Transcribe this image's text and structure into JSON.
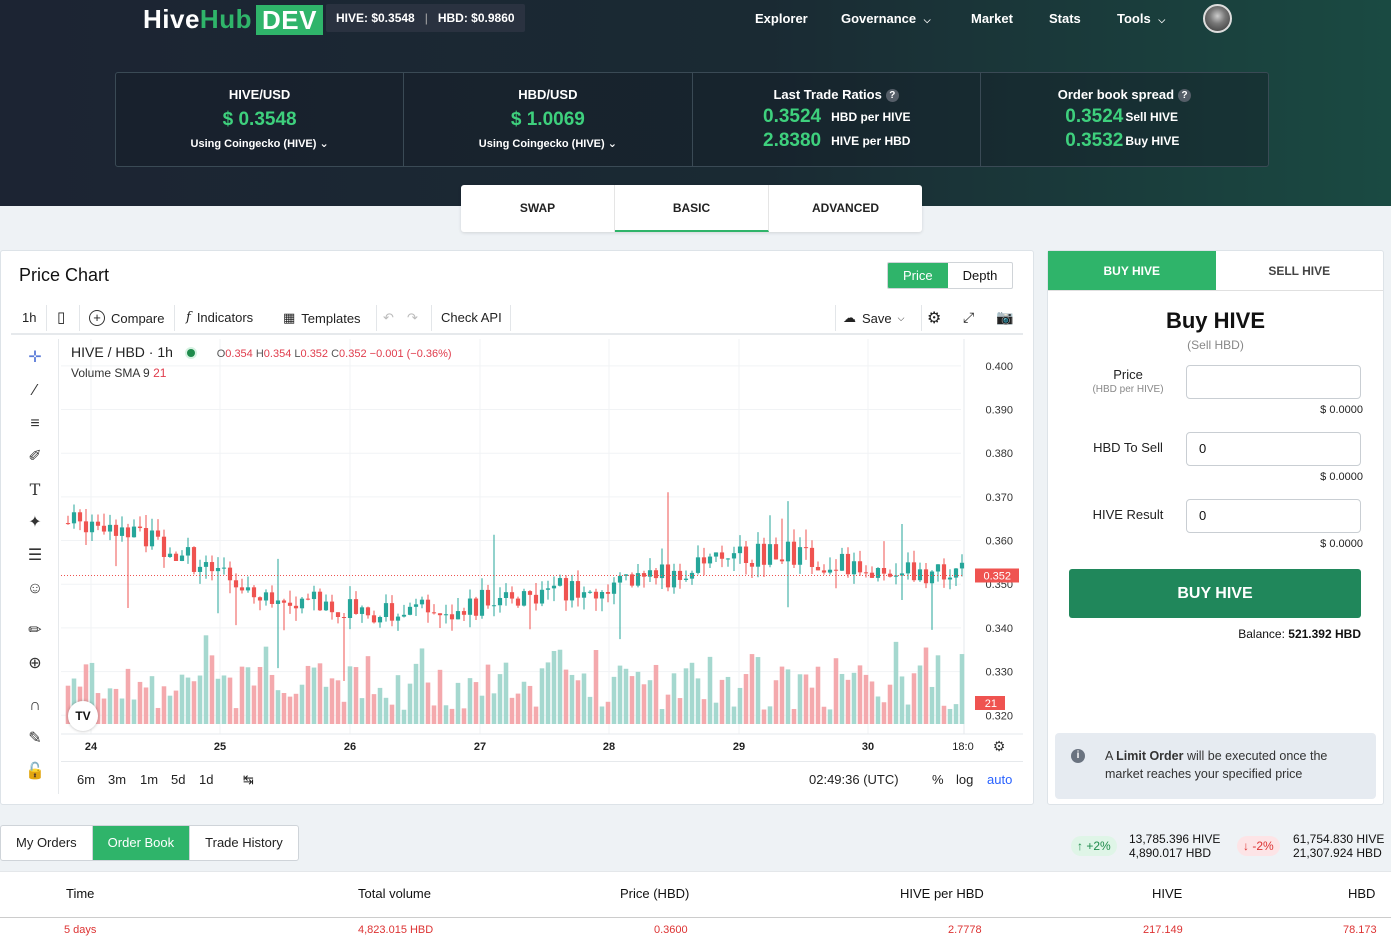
{
  "header": {
    "logo_a": "Hive",
    "logo_b": "Hub",
    "logo_dev": "DEV",
    "ticker_hive": "HIVE: $0.3548",
    "ticker_hbd": "HBD: $0.9860",
    "nav": [
      "Explorer",
      "Governance",
      "Market",
      "Stats",
      "Tools"
    ]
  },
  "stats": {
    "hive_usd": {
      "title": "HIVE/USD",
      "value": "$ 0.3548",
      "source": "Using Coingecko (HIVE)"
    },
    "hbd_usd": {
      "title": "HBD/USD",
      "value": "$ 1.0069",
      "source": "Using Coingecko (HIVE)"
    },
    "ratios": {
      "title": "Last Trade Ratios",
      "v1": "0.3524",
      "t1": "HBD per HIVE",
      "v2": "2.8380",
      "t2": "HIVE per HBD"
    },
    "spread": {
      "title": "Order book spread",
      "v1": "0.3524",
      "t1": "Sell HIVE",
      "v2": "0.3532",
      "t2": "Buy HIVE"
    }
  },
  "mode_tabs": [
    "SWAP",
    "BASIC",
    "ADVANCED"
  ],
  "chart": {
    "title": "Price Chart",
    "toggle": [
      "Price",
      "Depth"
    ],
    "toolbar": {
      "interval": "1h",
      "compare": "Compare",
      "indicators": "Indicators",
      "templates": "Templates",
      "check_api": "Check API",
      "save": "Save"
    },
    "legend": {
      "symbol": "HIVE / HBD · 1h",
      "o": "0.354",
      "h": "0.354",
      "l": "0.352",
      "c": "0.352",
      "chg": "−0.001 (−0.36%)",
      "volume": "Volume SMA 9",
      "volume_val": "21"
    },
    "price_label": "0.352",
    "volume_label": "21",
    "bottom": {
      "ranges": [
        "6m",
        "3m",
        "1m",
        "5d",
        "1d"
      ],
      "time": "02:49:36 (UTC)",
      "pct": "%",
      "log": "log",
      "auto": "auto"
    }
  },
  "chart_data": {
    "type": "candlestick",
    "title": "",
    "y_ticks": [
      "0.400",
      "0.390",
      "0.380",
      "0.370",
      "0.360",
      "0.350",
      "0.340",
      "0.330",
      "0.320"
    ],
    "x_ticks": [
      "24",
      "25",
      "26",
      "27",
      "28",
      "29",
      "30",
      "18:0"
    ],
    "ylim": [
      0.318,
      0.405
    ],
    "last_close": 0.352,
    "trend": [
      0.364,
      0.365,
      0.363,
      0.36,
      0.356,
      0.353,
      0.35,
      0.348,
      0.346,
      0.345,
      0.344,
      0.343,
      0.344,
      0.345,
      0.346,
      0.347,
      0.348,
      0.349,
      0.35,
      0.351,
      0.352,
      0.353,
      0.355,
      0.357,
      0.358,
      0.356,
      0.354,
      0.353,
      0.354,
      0.353,
      0.352
    ],
    "volume_max": 100
  },
  "buy": {
    "tabs": [
      "BUY HIVE",
      "SELL HIVE"
    ],
    "heading": "Buy HIVE",
    "sub": "(Sell HBD)",
    "price_label": "Price",
    "price_sub": "(HBD per HIVE)",
    "price_value": "",
    "price_usd": "$ 0.0000",
    "sell_label": "HBD To Sell",
    "sell_value": "0",
    "sell_usd": "$ 0.0000",
    "result_label": "HIVE Result",
    "result_value": "0",
    "result_usd": "$ 0.0000",
    "button": "BUY HIVE",
    "balance_label": "Balance:",
    "balance": "521.392 HBD",
    "info_pre": "A ",
    "info_bold": "Limit Order",
    "info_post": " will be executed once the market reaches your specified price"
  },
  "orders": {
    "tabs": [
      "My Orders",
      "Order Book",
      "Trade History"
    ],
    "up_pill": "↑ +2%",
    "up_hive": "13,785.396 HIVE",
    "up_hbd": "4,890.017 HBD",
    "dn_pill": "↓ -2%",
    "dn_hive": "61,754.830 HIVE",
    "dn_hbd": "21,307.924 HBD",
    "columns": [
      "Time",
      "Total volume",
      "Price (HBD)",
      "HIVE per HBD",
      "HIVE",
      "HBD"
    ],
    "row": [
      "5 days",
      "4,823.015 HBD",
      "0.3600",
      "2.7778",
      "217.149",
      "78.173"
    ]
  }
}
